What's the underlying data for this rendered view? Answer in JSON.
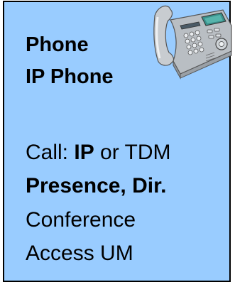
{
  "card": {
    "heading_line1": "Phone",
    "heading_line2": "IP Phone",
    "call": {
      "prefix": "Call: ",
      "strong": "IP",
      "suffix": " or TDM"
    },
    "presence": "Presence, Dir.",
    "conference": "Conference",
    "access": "Access UM",
    "icon": "desk-phone-icon"
  },
  "colors": {
    "background": "#99ccff",
    "border": "#000000",
    "text": "#000000"
  }
}
